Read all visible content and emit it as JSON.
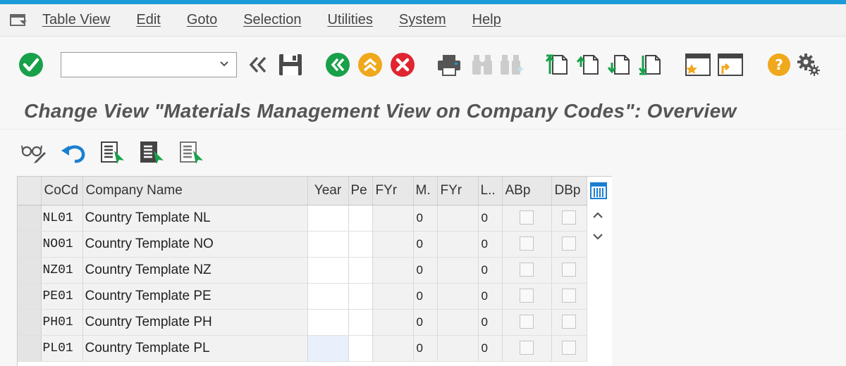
{
  "menu": {
    "items": [
      "Table View",
      "Edit",
      "Goto",
      "Selection",
      "Utilities",
      "System",
      "Help"
    ]
  },
  "command_field": {
    "value": ""
  },
  "title": "Change View \"Materials Management View on Company Codes\": Overview",
  "colors": {
    "accent": "#1b9bd7",
    "ok_green": "#19a04a",
    "warn_orange": "#f0a81c",
    "cancel_red": "#e0262f",
    "help_orange": "#f0a81c"
  },
  "table": {
    "columns": [
      "CoCd",
      "Company Name",
      "Year",
      "Pe",
      "FYr",
      "M.",
      "FYr",
      "L..",
      "ABp",
      "DBp"
    ],
    "rows": [
      {
        "cocd": "NL01",
        "name": "Country Template NL",
        "year": "",
        "pe": "",
        "fyr": "",
        "m": "0",
        "fyr2": "",
        "l": "0"
      },
      {
        "cocd": "NO01",
        "name": "Country Template NO",
        "year": "",
        "pe": "",
        "fyr": "",
        "m": "0",
        "fyr2": "",
        "l": "0"
      },
      {
        "cocd": "NZ01",
        "name": "Country Template NZ",
        "year": "",
        "pe": "",
        "fyr": "",
        "m": "0",
        "fyr2": "",
        "l": "0"
      },
      {
        "cocd": "PE01",
        "name": "Country Template PE",
        "year": "",
        "pe": "",
        "fyr": "",
        "m": "0",
        "fyr2": "",
        "l": "0"
      },
      {
        "cocd": "PH01",
        "name": "Country Template PH",
        "year": "",
        "pe": "",
        "fyr": "",
        "m": "0",
        "fyr2": "",
        "l": "0"
      },
      {
        "cocd": "PL01",
        "name": "Country Template PL",
        "year": "",
        "pe": "",
        "fyr": "",
        "m": "0",
        "fyr2": "",
        "l": "0"
      }
    ]
  }
}
